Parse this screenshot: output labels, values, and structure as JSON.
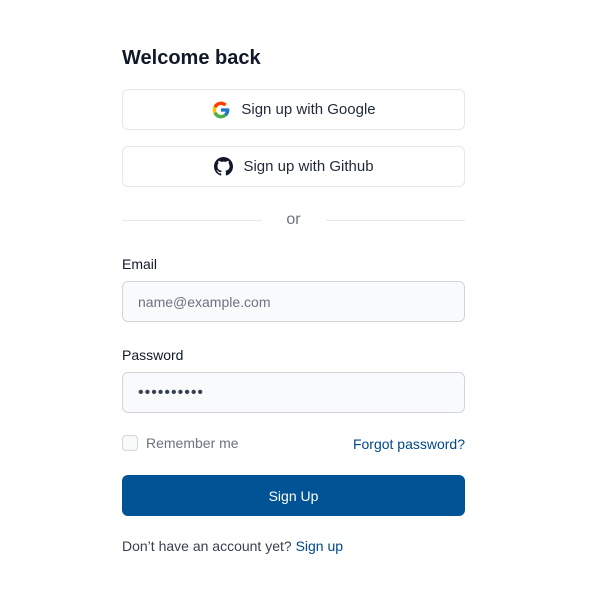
{
  "form": {
    "title": "Welcome back",
    "google_button_label": "Sign up with Google",
    "github_button_label": "Sign up with Github",
    "divider_text": "or",
    "email_label": "Email",
    "email_placeholder": "name@example.com",
    "email_value": "",
    "password_label": "Password",
    "password_value": "••••••••••",
    "remember_label": "Remember me",
    "remember_checked": false,
    "forgot_link": "Forgot password?",
    "submit_label": "Sign Up",
    "footer_text": "Don’t have an account yet?",
    "footer_link": "Sign up"
  },
  "icons": {
    "google": "google-logo-icon",
    "github": "github-logo-icon"
  },
  "colors": {
    "primary": "#005395",
    "link": "#00478a",
    "border": "#e5e7eb",
    "input_bg": "#f9fafb"
  }
}
